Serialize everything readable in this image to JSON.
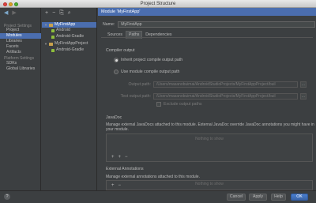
{
  "window": {
    "title": "Project Structure"
  },
  "nav": {
    "project_settings_header": "Project Settings",
    "platform_settings_header": "Platform Settings",
    "project_settings": [
      "Project",
      "Modules",
      "Libraries",
      "Facets",
      "Artifacts"
    ],
    "platform_settings": [
      "SDKs",
      "Global Libraries"
    ],
    "selected": "Modules"
  },
  "tree": {
    "nodes": [
      {
        "label": "MyFirstApp",
        "selected": true
      },
      {
        "label": "Android"
      },
      {
        "label": "Android-Gradle"
      },
      {
        "label": "MyFirstAppProject"
      },
      {
        "label": "Android-Gradle"
      }
    ]
  },
  "module": {
    "header": "Module 'MyFirstApp'",
    "name_label": "Name:",
    "name_value": "MyFirstApp",
    "tabs": [
      "Sources",
      "Paths",
      "Dependencies"
    ],
    "active_tab": "Paths"
  },
  "compiler_output": {
    "title": "Compiler output",
    "inherit_label": "Inherit project compile output path",
    "use_module_label": "Use module compile output path",
    "output_path_label": "Output path:",
    "output_path_value": "/Users/masanobuimai/AndroidStudioProjects/MyFirstAppProject/buil",
    "test_output_path_label": "Test output path:",
    "test_output_path_value": "/Users/masanobuimai/AndroidStudioProjects/MyFirstAppProject/buil",
    "exclude_label": "Exclude output paths",
    "browse_label": "..."
  },
  "javadoc": {
    "title": "JavaDoc",
    "description": "Manage external JavaDocs attached to this module. External JavaDoc override JavaDoc annotations you might have in your module.",
    "empty_text": "Nothing to show"
  },
  "annotations": {
    "title": "External Annotations",
    "description": "Manage external annotations attached to this module.",
    "empty_text": "Nothing to show"
  },
  "footer": {
    "help_icon": "?",
    "cancel": "Cancel",
    "apply": "Apply",
    "help": "Help",
    "ok": "OK"
  },
  "icons": {
    "back": "◀",
    "forward": "▶",
    "add": "+",
    "remove": "−",
    "copy": "⎘",
    "find": "⌕",
    "add_url": "+"
  },
  "colors": {
    "accent": "#4b6eaf",
    "background": "#3c3f41"
  }
}
